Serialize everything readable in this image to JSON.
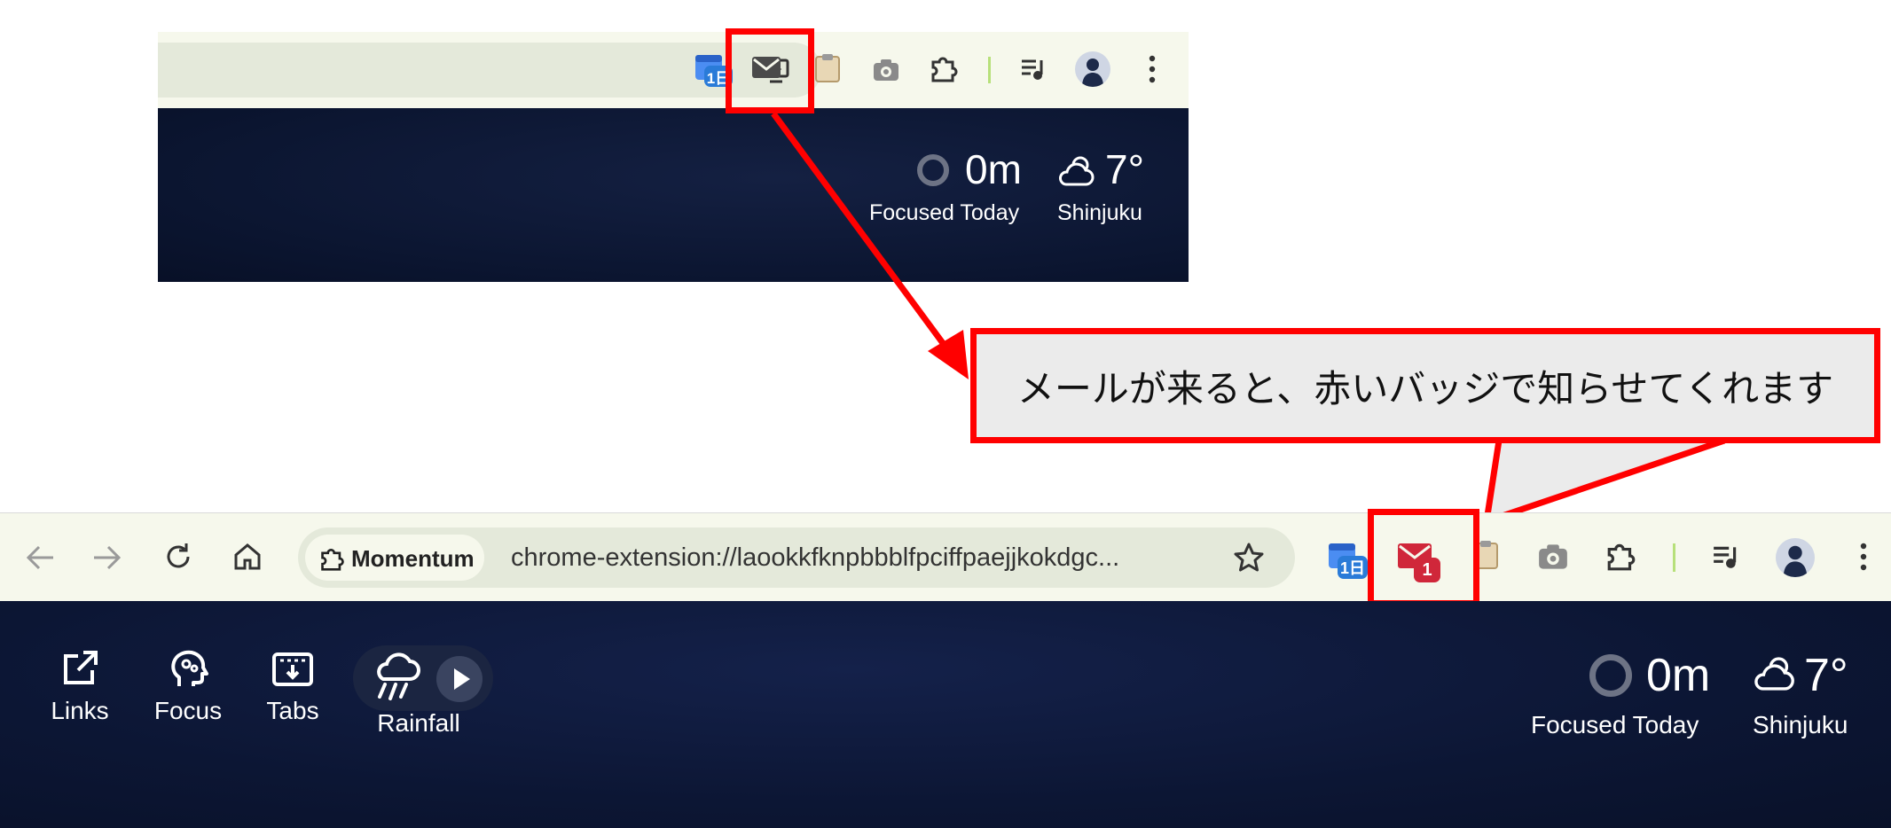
{
  "top_snippet": {
    "focus": {
      "value": "0m",
      "label": "Focused Today"
    },
    "weather": {
      "temp": "7°",
      "location": "Shinjuku"
    },
    "calendar_badge": "1日"
  },
  "callout": {
    "text": "メールが来ると、赤いバッジで知らせてくれます"
  },
  "bottom": {
    "omnibox": {
      "chip_label": "Momentum",
      "url": "chrome-extension://laookkfknpbbblfpciffpaejjkokdgc..."
    },
    "mail_badge": "1",
    "calendar_badge": "1日",
    "dashboard": {
      "links_label": "Links",
      "focus_label": "Focus",
      "tabs_label": "Tabs",
      "rainfall_label": "Rainfall",
      "focus_value": "0m",
      "focus_caption": "Focused Today",
      "weather_temp": "7°",
      "weather_location": "Shinjuku"
    }
  },
  "colors": {
    "highlight": "#ff0000",
    "badge": "#d0273a",
    "toolbar": "#f6f8ec",
    "dashboard": "#0c1634"
  }
}
